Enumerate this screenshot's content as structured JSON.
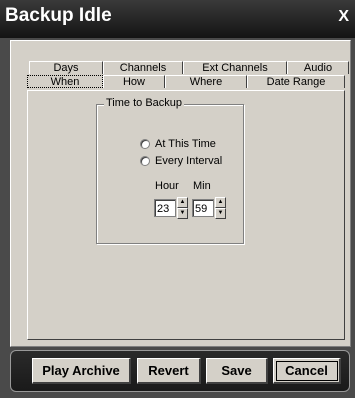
{
  "window": {
    "title": "Backup Idle",
    "close_label": "X"
  },
  "tabs": {
    "back_row": [
      "Days",
      "Channels",
      "Ext Channels",
      "Audio"
    ],
    "front_row": [
      "When",
      "How",
      "Where",
      "Date Range"
    ],
    "selected": "When"
  },
  "when_panel": {
    "group_title": "Time to Backup",
    "radio_at_time": "At This Time",
    "radio_every_interval": "Every Interval",
    "hour_label": "Hour",
    "min_label": "Min",
    "hour_value": "23",
    "min_value": "59"
  },
  "buttons": {
    "play_archive": "Play Archive",
    "revert": "Revert",
    "save": "Save",
    "cancel": "Cancel"
  }
}
